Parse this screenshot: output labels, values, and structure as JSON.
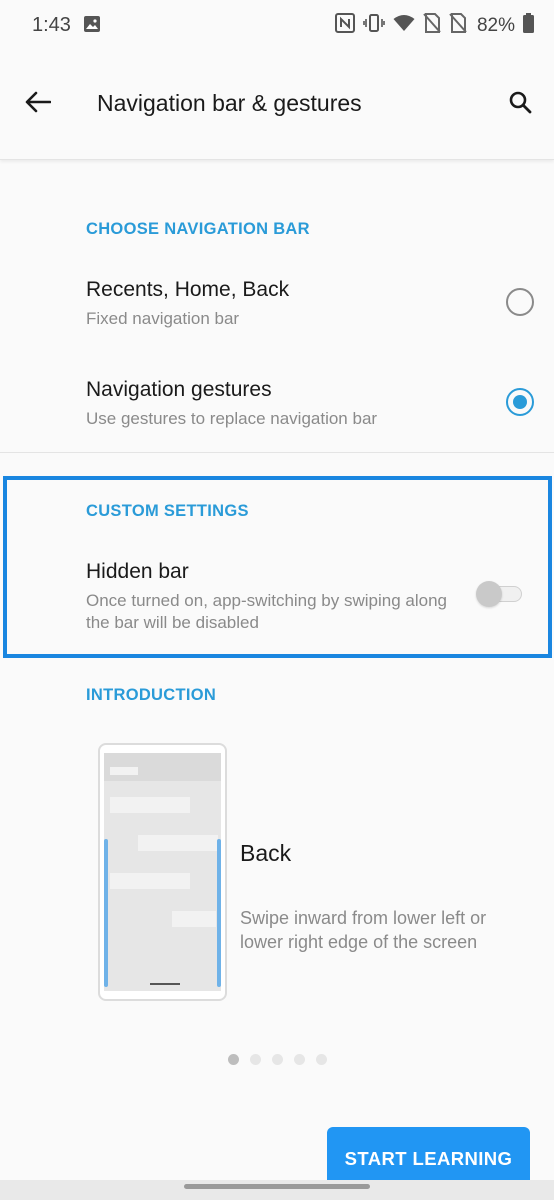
{
  "status_bar": {
    "time": "1:43",
    "battery": "82%",
    "icons": [
      "image-icon",
      "nfc-icon",
      "vibrate-icon",
      "wifi-icon",
      "no-sim-icon",
      "no-sim-icon",
      "battery-icon"
    ]
  },
  "app_bar": {
    "title": "Navigation bar & gestures",
    "back_icon": "arrow-left-icon",
    "search_icon": "search-icon"
  },
  "choose_section": {
    "header": "CHOOSE NAVIGATION BAR",
    "options": [
      {
        "title": "Recents, Home, Back",
        "subtitle": "Fixed navigation bar",
        "selected": false
      },
      {
        "title": "Navigation gestures",
        "subtitle": "Use gestures to replace navigation bar",
        "selected": true
      }
    ]
  },
  "custom_section": {
    "header": "CUSTOM SETTINGS",
    "hidden_bar": {
      "title": "Hidden bar",
      "subtitle": "Once turned on, app-switching by swiping along the bar will be disabled",
      "enabled": false
    }
  },
  "intro_section": {
    "header": "INTRODUCTION",
    "title": "Back",
    "description": "Swipe inward from lower left or lower right edge of the screen",
    "page_count": 5,
    "current_page": 1
  },
  "start_button": {
    "label": "START LEARNING"
  },
  "colors": {
    "accent": "#2a9bd8",
    "button": "#2196f3",
    "highlight": "#1a86e0"
  }
}
